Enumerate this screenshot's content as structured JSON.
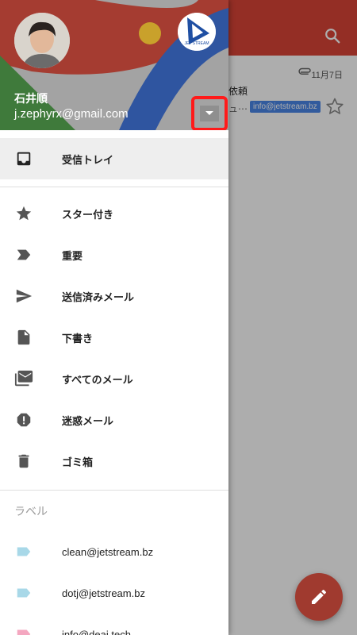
{
  "background": {
    "message": {
      "date": "11月7日",
      "subject": "依頼",
      "snippet": "ュ⋯",
      "tag": "info@jetstream.bz"
    }
  },
  "account": {
    "name": "石井順",
    "email": "j.zephyrx@gmail.com",
    "logo_text": "JET STREAM"
  },
  "nav": [
    {
      "label": "受信トレイ",
      "icon": "inbox-icon"
    },
    {
      "label": "スター付き",
      "icon": "star-icon"
    },
    {
      "label": "重要",
      "icon": "important-icon"
    },
    {
      "label": "送信済みメール",
      "icon": "send-icon"
    },
    {
      "label": "下書き",
      "icon": "draft-icon"
    },
    {
      "label": "すべてのメール",
      "icon": "all-mail-icon"
    },
    {
      "label": "迷惑メール",
      "icon": "spam-icon"
    },
    {
      "label": "ゴミ箱",
      "icon": "trash-icon"
    }
  ],
  "labels_section": {
    "title": "ラベル",
    "items": [
      {
        "label": "clean@jetstream.bz",
        "color": "#a8d8e8"
      },
      {
        "label": "dotj@jetstream.bz",
        "color": "#a8d8e8"
      },
      {
        "label": "info@deai.tech",
        "color": "#f4a7c0"
      }
    ]
  },
  "colors": {
    "primary": "#db4437",
    "highlight_box": "#ff1a1a",
    "tag": "#4a86e8"
  }
}
